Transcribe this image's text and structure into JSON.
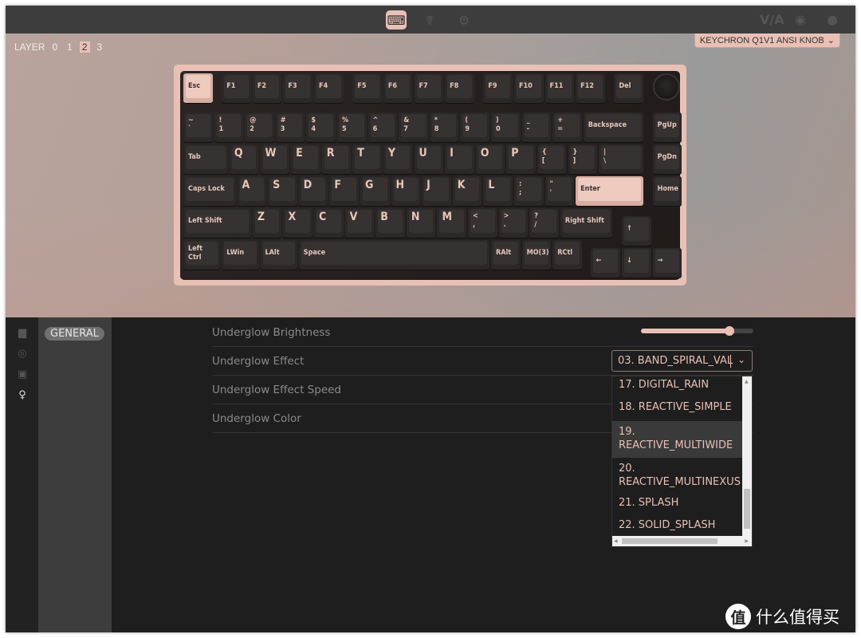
{
  "topbar": {
    "icons": [
      "keyboard-icon",
      "stethoscope-icon",
      "gear-icon"
    ],
    "via_logo": "V/A",
    "right_icons": [
      "discord-icon",
      "github-icon"
    ]
  },
  "layers": {
    "label": "LAYER",
    "items": [
      "0",
      "1",
      "2",
      "3"
    ],
    "active": "2"
  },
  "keyboard_select": {
    "value": "KEYCHRON Q1V1 ANSI KNOB"
  },
  "keyboard": {
    "rows": [
      [
        {
          "t": "Esc",
          "hl": true
        },
        {
          "t": "F1"
        },
        {
          "t": "F2"
        },
        {
          "t": "F3"
        },
        {
          "t": "F4"
        },
        {
          "t": "F5"
        },
        {
          "t": "F6"
        },
        {
          "t": "F7"
        },
        {
          "t": "F8"
        },
        {
          "t": "F9"
        },
        {
          "t": "F10"
        },
        {
          "t": "F11"
        },
        {
          "t": "F12"
        },
        {
          "t": "Del"
        }
      ],
      [
        {
          "t": "~",
          "b": "`"
        },
        {
          "t": "!",
          "b": "1"
        },
        {
          "t": "@",
          "b": "2"
        },
        {
          "t": "#",
          "b": "3"
        },
        {
          "t": "$",
          "b": "4"
        },
        {
          "t": "%",
          "b": "5"
        },
        {
          "t": "^",
          "b": "6"
        },
        {
          "t": "&",
          "b": "7"
        },
        {
          "t": "*",
          "b": "8"
        },
        {
          "t": "(",
          "b": "9"
        },
        {
          "t": ")",
          "b": "0"
        },
        {
          "t": "_",
          "b": "-"
        },
        {
          "t": "+",
          "b": "="
        },
        {
          "t": "Backspace"
        },
        {
          "t": "PgUp"
        }
      ],
      [
        {
          "t": "Tab"
        },
        {
          "t": "Q",
          "big": true
        },
        {
          "t": "W",
          "big": true
        },
        {
          "t": "E",
          "big": true
        },
        {
          "t": "R",
          "big": true
        },
        {
          "t": "T",
          "big": true
        },
        {
          "t": "Y",
          "big": true
        },
        {
          "t": "U",
          "big": true
        },
        {
          "t": "I",
          "big": true
        },
        {
          "t": "O",
          "big": true
        },
        {
          "t": "P",
          "big": true
        },
        {
          "t": "{",
          "b": "["
        },
        {
          "t": "}",
          "b": "]"
        },
        {
          "t": "|",
          "b": "\\"
        },
        {
          "t": "PgDn"
        }
      ],
      [
        {
          "t": "Caps Lock"
        },
        {
          "t": "A",
          "big": true
        },
        {
          "t": "S",
          "big": true
        },
        {
          "t": "D",
          "big": true
        },
        {
          "t": "F",
          "big": true
        },
        {
          "t": "G",
          "big": true
        },
        {
          "t": "H",
          "big": true
        },
        {
          "t": "J",
          "big": true
        },
        {
          "t": "K",
          "big": true
        },
        {
          "t": "L",
          "big": true
        },
        {
          "t": ":",
          "b": ";"
        },
        {
          "t": "\"",
          "b": "'"
        },
        {
          "t": "Enter",
          "hl": true
        },
        {
          "t": "Home"
        }
      ],
      [
        {
          "t": "Left Shift"
        },
        {
          "t": "Z",
          "big": true
        },
        {
          "t": "X",
          "big": true
        },
        {
          "t": "C",
          "big": true
        },
        {
          "t": "V",
          "big": true
        },
        {
          "t": "B",
          "big": true
        },
        {
          "t": "N",
          "big": true
        },
        {
          "t": "M",
          "big": true
        },
        {
          "t": "<",
          "b": ","
        },
        {
          "t": ">",
          "b": "."
        },
        {
          "t": "?",
          "b": "/"
        },
        {
          "t": "Right Shift"
        },
        {
          "t": "↑"
        }
      ],
      [
        {
          "t": "Left Ctrl"
        },
        {
          "t": "LWin"
        },
        {
          "t": "LAlt"
        },
        {
          "t": "Space"
        },
        {
          "t": "RAlt"
        },
        {
          "t": "MO(3)"
        },
        {
          "t": "RCtl"
        },
        {
          "t": "←"
        },
        {
          "t": "↓"
        },
        {
          "t": "→"
        }
      ]
    ]
  },
  "sidebar_icons": [
    "keymap-icon",
    "macro-icon",
    "save-icon",
    "lightbulb-icon"
  ],
  "submenu": {
    "general": "GENERAL"
  },
  "settings": {
    "rows": [
      "Underglow Brightness",
      "Underglow Effect",
      "Underglow Effect Speed",
      "Underglow Color"
    ],
    "brightness_percent": 79,
    "effect_value": "03. BAND_SPIRAL_VAL",
    "options": [
      "17. DIGITAL_RAIN",
      "18. REACTIVE_SIMPLE",
      "19. REACTIVE_MULTIWIDE",
      "20. REACTIVE_MULTINEXUS",
      "21. SPLASH",
      "22. SOLID_SPLASH"
    ],
    "hovered_option": "19. REACTIVE_MULTIWIDE"
  },
  "watermark": {
    "logo": "值",
    "text": "什么值得买"
  },
  "colors": {
    "accent": "#e9c0b5",
    "topbar": "#3d3d3d",
    "background": "#1e1e1e"
  }
}
